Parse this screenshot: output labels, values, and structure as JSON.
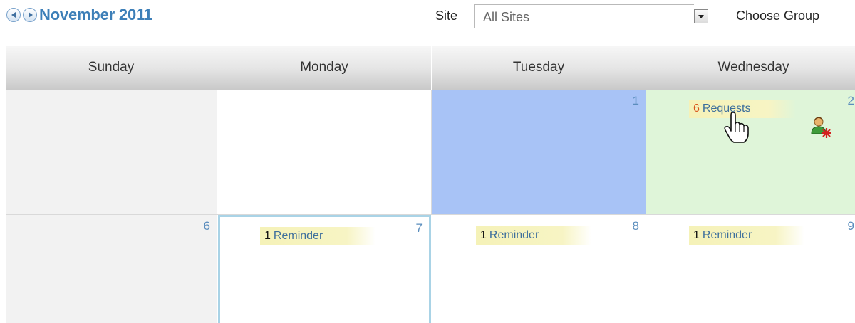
{
  "header": {
    "month_title": "November 2011",
    "site_label": "Site",
    "site_value": "All Sites",
    "choose_group": "Choose Group"
  },
  "calendar": {
    "weekdays": [
      "Sunday",
      "Monday",
      "Tuesday",
      "Wednesday"
    ],
    "weeks": [
      [
        {
          "day": ""
        },
        {
          "day": ""
        },
        {
          "day": "1"
        },
        {
          "day": "2",
          "event": {
            "count": "6",
            "label": "Requests"
          }
        }
      ],
      [
        {
          "day": "6"
        },
        {
          "day": "7",
          "event": {
            "count": "1",
            "label": "Reminder"
          }
        },
        {
          "day": "8",
          "event": {
            "count": "1",
            "label": "Reminder"
          }
        },
        {
          "day": "9",
          "event": {
            "count": "1",
            "label": "Reminder"
          }
        }
      ]
    ]
  },
  "colors": {
    "title_blue": "#3d7fb8",
    "selected_day": "#a8c3f6",
    "today_green": "#dff5d9",
    "event_highlight": "#f6f3bc",
    "alert_count": "#d8541b",
    "focused_border": "#a9d3e6"
  },
  "icons": {
    "prev": "prev-month-icon",
    "next": "next-month-icon",
    "dropdown": "dropdown-arrow-icon",
    "user_alert": "user-alert-icon",
    "pointer": "hand-cursor-icon"
  }
}
